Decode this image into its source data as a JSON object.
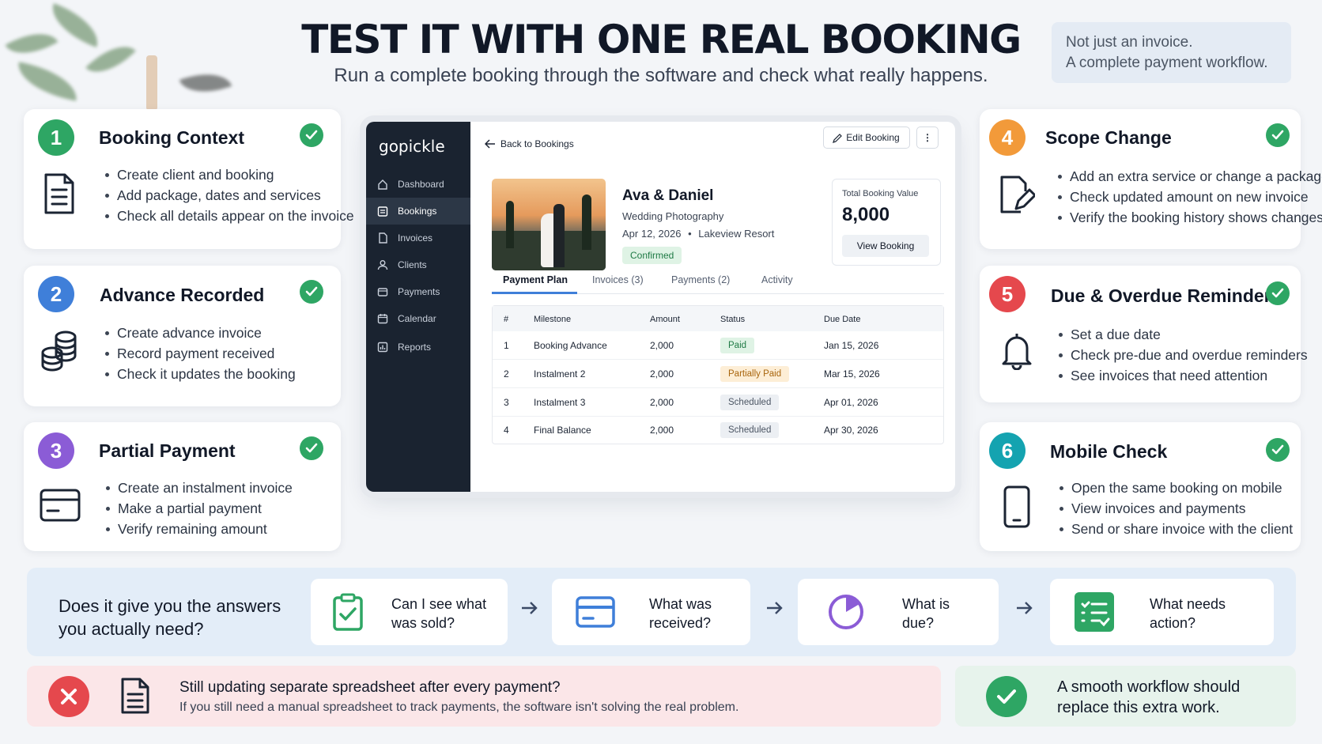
{
  "header": {
    "title": "TEST IT WITH ONE REAL BOOKING",
    "subtitle": "Run a complete booking through the software and check what really happens.",
    "note_line1": "Not just an invoice.",
    "note_line2": "A complete payment workflow."
  },
  "colors": {
    "green": "#2ea664",
    "blue": "#3f7fd9",
    "purple": "#8b5cd6",
    "orange": "#f29a3a",
    "red": "#e5484d",
    "teal": "#14a3b0",
    "alert_bg": "#fbe6e8",
    "ok_bg": "#e7f3ec",
    "question_bg": "#e3edf8"
  },
  "cards": [
    {
      "number": "1",
      "title": "Booking Context",
      "icon": "document-icon",
      "items": [
        "Create client and booking",
        "Add package, dates and services",
        "Check all details appear on the invoice"
      ]
    },
    {
      "number": "2",
      "title": "Advance Recorded",
      "icon": "coins-icon",
      "items": [
        "Create advance invoice",
        "Record payment received",
        "Check it updates the booking"
      ]
    },
    {
      "number": "3",
      "title": "Partial Payment",
      "icon": "credit-card-icon",
      "items": [
        "Create an instalment invoice",
        "Make a partial payment",
        "Verify remaining amount"
      ]
    },
    {
      "number": "4",
      "title": "Scope Change",
      "icon": "edit-document-icon",
      "items": [
        "Add an extra service or change a package",
        "Check updated amount on new invoice",
        "Verify the booking history shows changes"
      ]
    },
    {
      "number": "5",
      "title": "Due & Overdue Reminder",
      "icon": "bell-icon",
      "items": [
        "Set a due date",
        "Check pre-due and overdue reminders",
        "See invoices that need attention"
      ]
    },
    {
      "number": "6",
      "title": "Mobile Check",
      "icon": "mobile-icon",
      "items": [
        "Open the same booking on mobile",
        "View invoices and payments",
        "Send or share invoice with the client"
      ]
    }
  ],
  "app": {
    "logo": "gopickle",
    "nav": [
      "Dashboard",
      "Bookings",
      "Invoices",
      "Clients",
      "Payments",
      "Calendar",
      "Reports"
    ],
    "back": "Back to Bookings",
    "edit": "Edit Booking",
    "more": "⋮",
    "booking": {
      "name": "Ava & Daniel",
      "type": "Wedding Photography",
      "date": "Apr 12, 2026",
      "venue": "Lakeview Resort",
      "sep": "•",
      "status": "Confirmed"
    },
    "total": {
      "label": "Total Booking Value",
      "value": "8,000",
      "button": "View Booking"
    },
    "tabs": [
      "Payment Plan",
      "Invoices (3)",
      "Payments (2)",
      "Activity"
    ],
    "columns": [
      "#",
      "Milestone",
      "Amount",
      "Status",
      "Due Date"
    ],
    "rows": [
      {
        "n": "1",
        "milestone": "Booking Advance",
        "amount": "2,000",
        "status": "Paid",
        "due": "Jan 15, 2026"
      },
      {
        "n": "2",
        "milestone": "Instalment 2",
        "amount": "2,000",
        "status": "Partially Paid",
        "due": "Mar 15, 2026"
      },
      {
        "n": "3",
        "milestone": "Instalment 3",
        "amount": "2,000",
        "status": "Scheduled",
        "due": "Apr 01, 2026"
      },
      {
        "n": "4",
        "milestone": "Final Balance",
        "amount": "2,000",
        "status": "Scheduled",
        "due": "Apr 30, 2026"
      }
    ]
  },
  "questions": {
    "lead_line1": "Does it give you the answers",
    "lead_line2": "you actually need?",
    "items": [
      {
        "line1": "Can I see what",
        "line2": "was sold?",
        "icon": "clipboard-check-icon"
      },
      {
        "line1": "What was",
        "line2": "received?",
        "icon": "card-icon"
      },
      {
        "line1": "What is",
        "line2": "due?",
        "icon": "pie-chart-icon"
      },
      {
        "line1": "What needs",
        "line2": "action?",
        "icon": "checklist-icon"
      }
    ]
  },
  "footer": {
    "alert_title": "Still updating separate spreadsheet after every payment?",
    "alert_text": "If you still need a manual spreadsheet to track payments, the software isn't solving the real problem.",
    "ok_line1": "A smooth workflow should",
    "ok_line2": "replace this extra work."
  }
}
